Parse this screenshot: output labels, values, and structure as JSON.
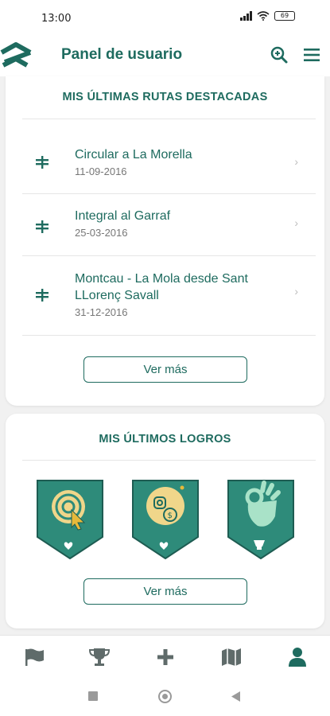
{
  "status_bar": {
    "time": "13:00",
    "battery": "69"
  },
  "header": {
    "title": "Panel de usuario",
    "icons": [
      "logo-icon",
      "search-icon",
      "menu-icon"
    ]
  },
  "routes_section": {
    "title": "MIS ÚLTIMAS RUTAS DESTACADAS",
    "items": [
      {
        "name": "Circular a La Morella",
        "date": "11-09-2016"
      },
      {
        "name": "Integral al Garraf",
        "date": "25-03-2016"
      },
      {
        "name_line1": "Montcau - La Mola desde Sant",
        "name_line2": "LLorenç Savall",
        "date": "31-12-2016"
      }
    ],
    "more_label": "Ver más"
  },
  "achievements_section": {
    "title": "MIS ÚLTIMOS LOGROS",
    "badges": [
      "target-click-badge",
      "social-coins-badge",
      "ok-hand-badge"
    ],
    "more_label": "Ver más"
  },
  "bottom_nav": {
    "items": [
      "flag-icon",
      "trophy-icon",
      "plus-icon",
      "map-icon",
      "user-icon"
    ],
    "active": "user-icon"
  },
  "colors": {
    "primary": "#1e6b5f",
    "badge_bg": "#2e8b7a",
    "badge_accent": "#f0d68a"
  }
}
